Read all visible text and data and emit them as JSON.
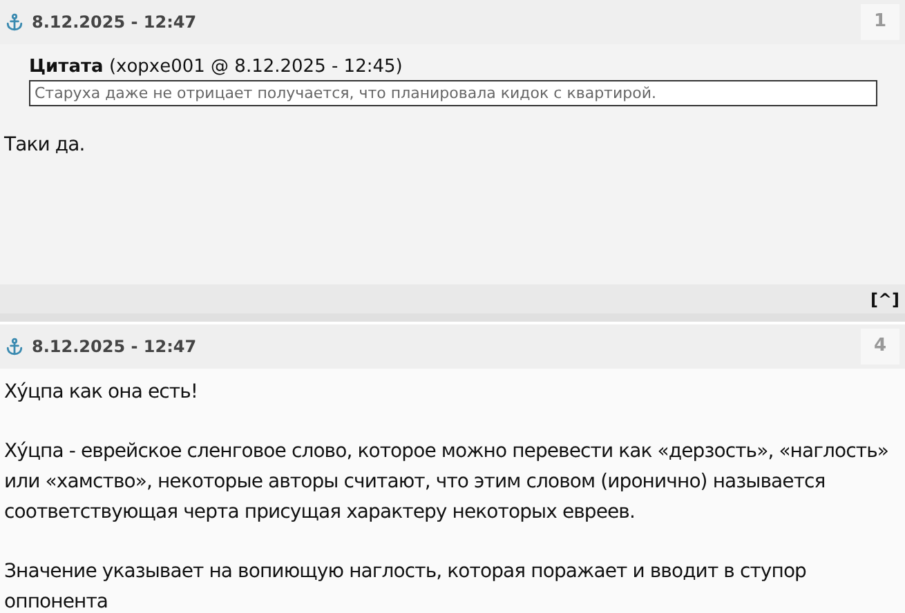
{
  "posts": [
    {
      "date": "8.12.2025 - 12:47",
      "number": "1",
      "quote": {
        "label": "Цитата",
        "source": "(хорхе001 @ 8.12.2025 - 12:45)",
        "text": "Старуха даже не отрицает получается, что планировала кидок с квартирой."
      },
      "paragraphs": [
        "Таки да."
      ],
      "top_link": "[^]"
    },
    {
      "date": "8.12.2025 - 12:47",
      "number": "4",
      "paragraphs": [
        "Хýцпа как она есть!",
        "Хýцпа - еврейское сленговое слово, которое можно перевести как «дерзость», «наглость» или «хамство», некоторые авторы считают, что этим словом (иронично) называется соответствующая черта присущая характеру некоторых евреев.",
        "Значение указывает на вопиющую наглость, которая поражает и вводит в ступор оппонента"
      ]
    }
  ]
}
